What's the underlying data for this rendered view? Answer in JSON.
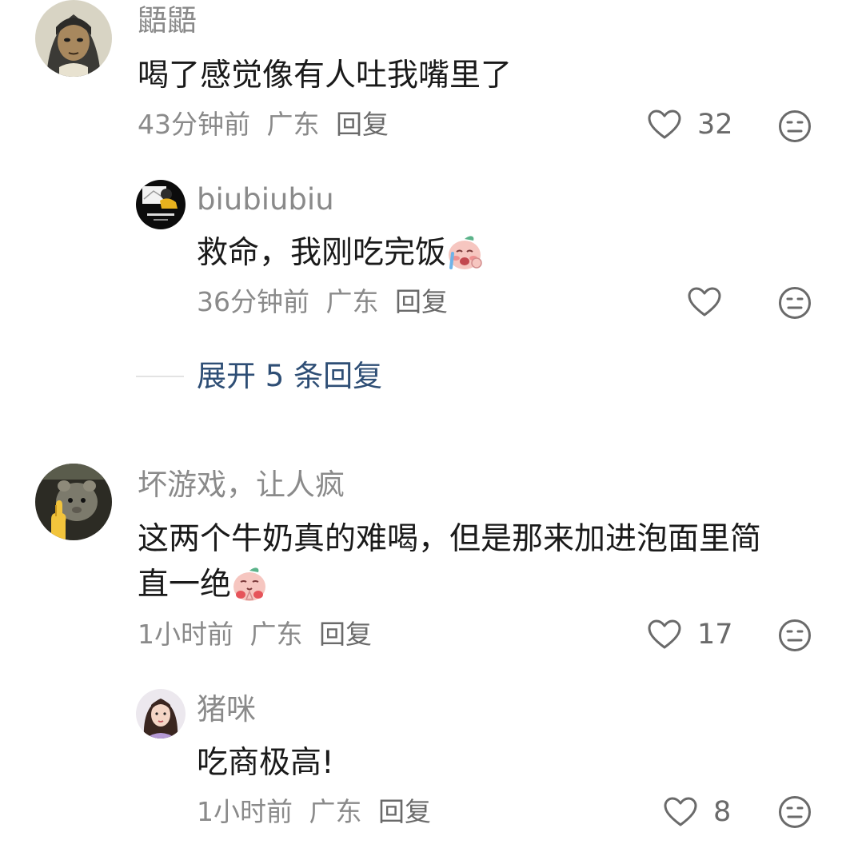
{
  "comments": [
    {
      "username": "鼯鼯",
      "text": "喝了感觉像有人吐我嘴里了",
      "time": "43分钟前",
      "location": "广东",
      "reply_label": "回复",
      "likes": "32",
      "avatar_icon": "cartoon-girl-avatar",
      "replies": [
        {
          "username": "biubiubiu",
          "text": "救命，我刚吃完饭",
          "emoji": "crying-peach-emoji",
          "time": "36分钟前",
          "location": "广东",
          "reply_label": "回复",
          "likes": "",
          "avatar_icon": "album-cover-avatar"
        }
      ],
      "expand_label": "展开 5 条回复"
    },
    {
      "username": "坏游戏，让人疯",
      "text_line1": "这两个牛奶真的难喝，但是那来加进泡面里简",
      "text_line2": "直一绝",
      "emoji": "praying-peach-emoji",
      "time": "1小时前",
      "location": "广东",
      "reply_label": "回复",
      "likes": "17",
      "avatar_icon": "mouse-hand-avatar",
      "replies": [
        {
          "username": "猪咪",
          "text": "吃商极高!",
          "time": "1小时前",
          "location": "广东",
          "reply_label": "回复",
          "likes": "8",
          "avatar_icon": "woman-photo-avatar"
        }
      ]
    }
  ],
  "colors": {
    "username": "#8a8a8a",
    "content": "#1a1a1a",
    "meta": "#8a8a8a",
    "expand": "#2e4e75",
    "icon": "#6a6a6a"
  }
}
